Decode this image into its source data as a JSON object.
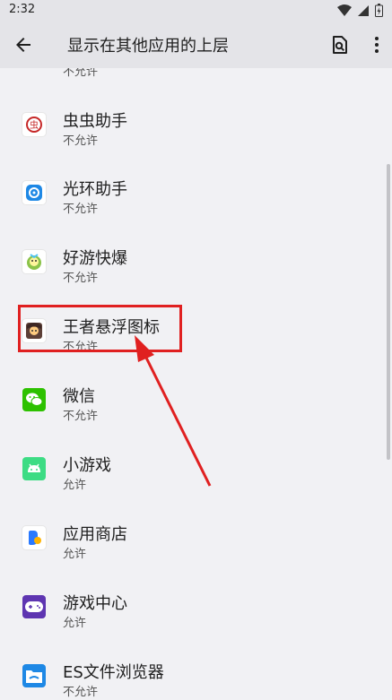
{
  "status_bar": {
    "time": "2:32"
  },
  "app_bar": {
    "title": "显示在其他应用的上层"
  },
  "partial_item_status": "不允许",
  "apps": [
    {
      "name": "虫虫助手",
      "status": "不允许",
      "icon": "chongchong-icon"
    },
    {
      "name": "光环助手",
      "status": "不允许",
      "icon": "guanghuan-icon"
    },
    {
      "name": "好游快爆",
      "status": "不允许",
      "icon": "haoyou-icon"
    },
    {
      "name": "王者悬浮图标",
      "status": "不允许",
      "icon": "wangzhe-icon"
    },
    {
      "name": "微信",
      "status": "不允许",
      "icon": "wechat-icon"
    },
    {
      "name": "小游戏",
      "status": "允许",
      "icon": "android-icon"
    },
    {
      "name": "应用商店",
      "status": "允许",
      "icon": "app-store-icon"
    },
    {
      "name": "游戏中心",
      "status": "允许",
      "icon": "gamepad-icon"
    },
    {
      "name": "ES文件浏览器",
      "status": "不允许",
      "icon": "es-explorer-icon"
    }
  ],
  "colors": {
    "highlight": "#e02020",
    "background": "#f1f1f4"
  }
}
